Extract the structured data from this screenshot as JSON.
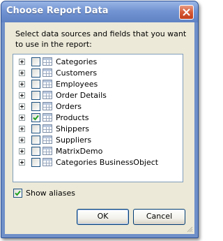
{
  "window": {
    "title": "Choose Report Data",
    "instructions": "Select data sources and fields that you want to use in the report:"
  },
  "items": [
    {
      "label": "Categories",
      "checked": false
    },
    {
      "label": "Customers",
      "checked": false
    },
    {
      "label": "Employees",
      "checked": false
    },
    {
      "label": "Order Details",
      "checked": false
    },
    {
      "label": "Orders",
      "checked": false
    },
    {
      "label": "Products",
      "checked": true
    },
    {
      "label": "Shippers",
      "checked": false
    },
    {
      "label": "Suppliers",
      "checked": false
    },
    {
      "label": "MatrixDemo",
      "checked": false
    },
    {
      "label": "Categories BusinessObject",
      "checked": false
    }
  ],
  "options": {
    "show_aliases_label": "Show aliases",
    "show_aliases_checked": true
  },
  "buttons": {
    "ok_label": "OK",
    "cancel_label": "Cancel"
  },
  "colors": {
    "title_bar": "#7394d2",
    "close_button": "#d55a36",
    "dialog_bg": "#ece9d8",
    "check_mark": "#21a121"
  }
}
